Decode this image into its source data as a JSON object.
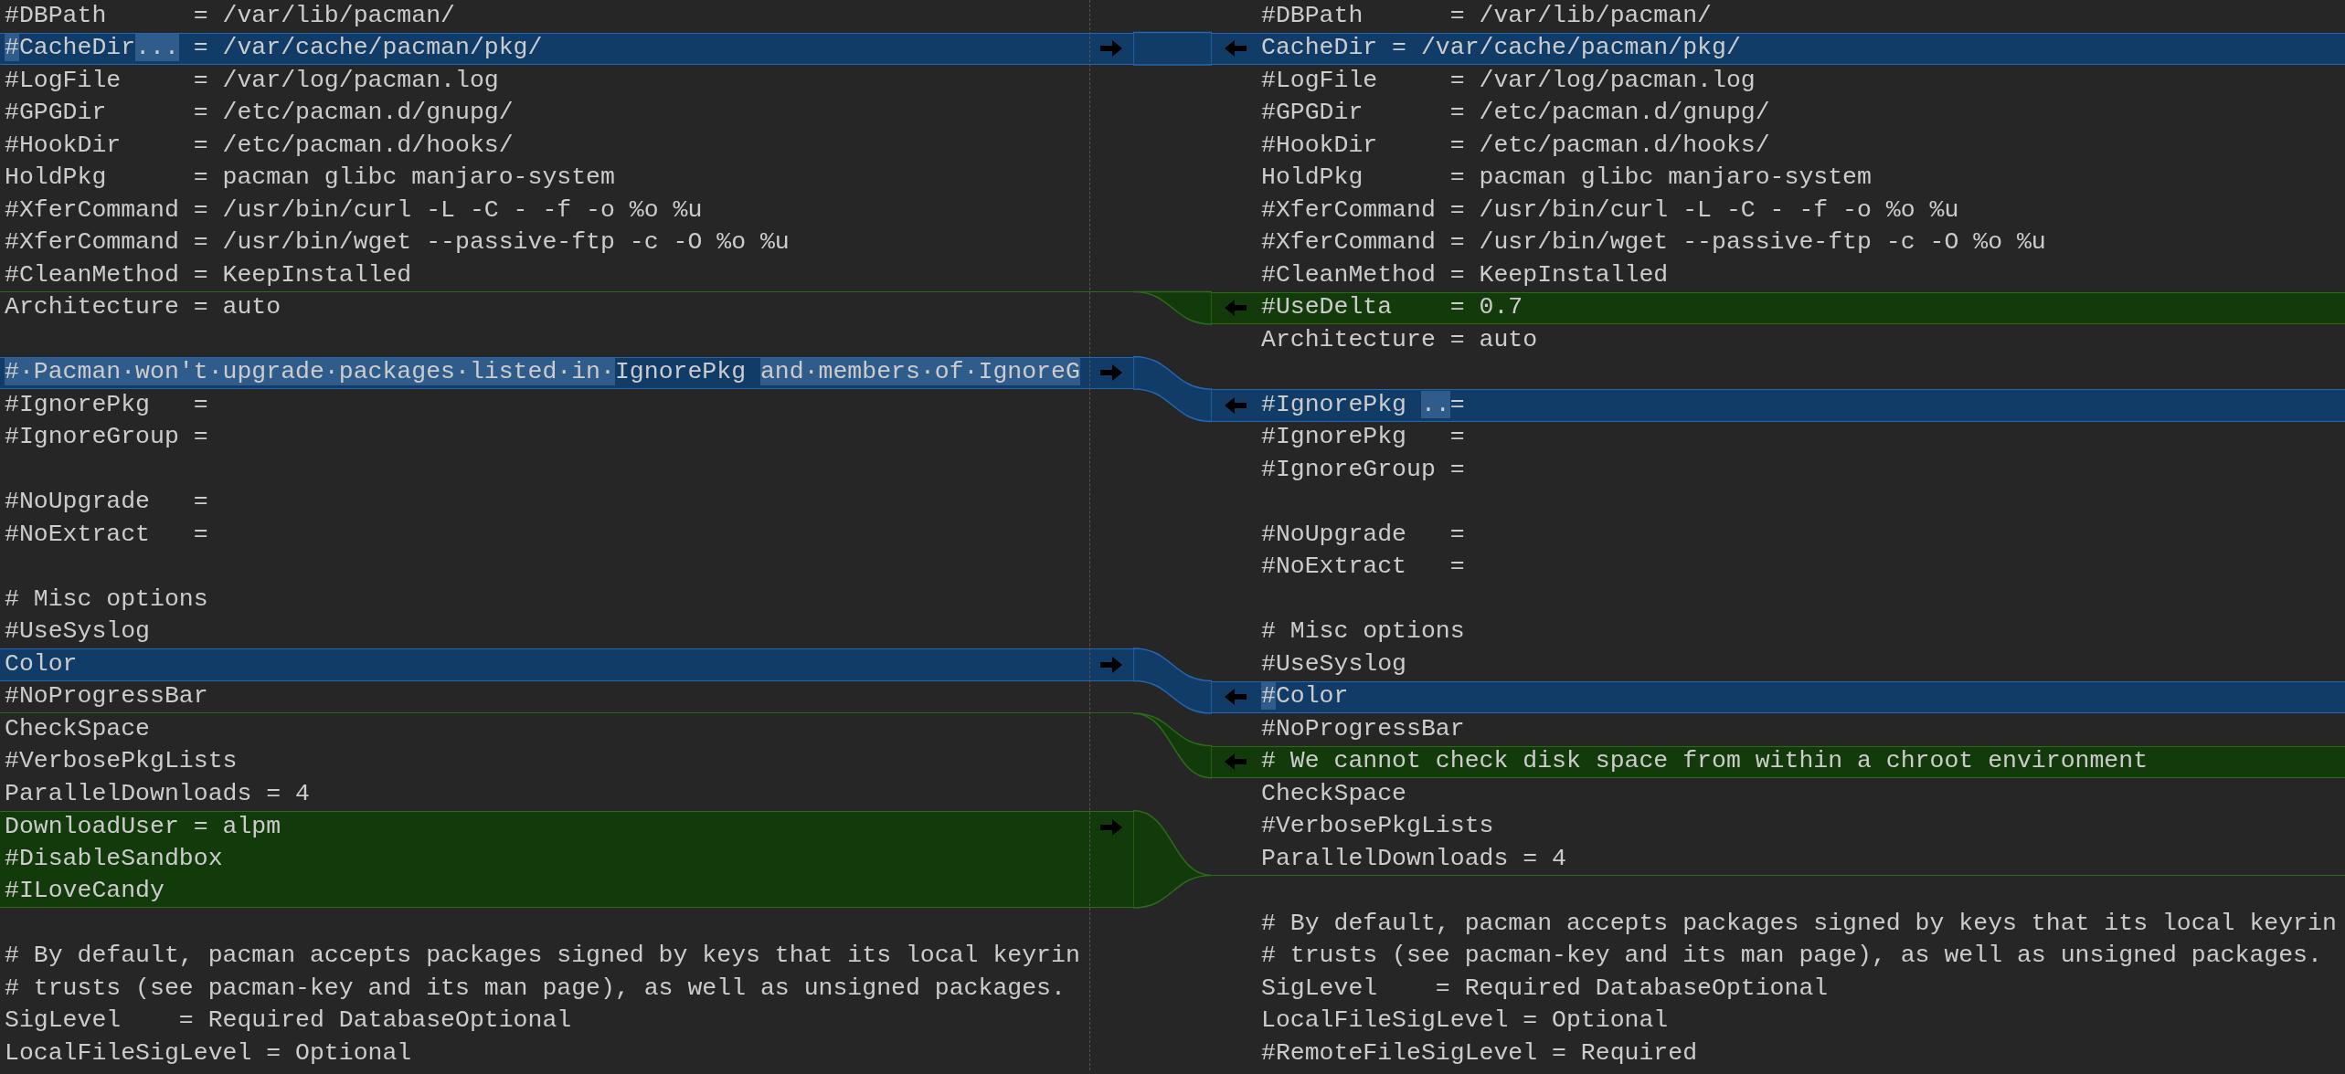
{
  "blocks": [
    {
      "kind": "equal",
      "left": [
        {
          "kind": "text",
          "text": "#DBPath      = /var/lib/pacman/"
        }
      ],
      "right": [
        {
          "kind": "text",
          "text": "#DBPath      = /var/lib/pacman/"
        }
      ]
    },
    {
      "kind": "changed",
      "left": [
        {
          "kind": "diff",
          "segments": [
            {
              "text": "#",
              "highlight": true
            },
            {
              "text": "CacheDir",
              "highlight": false
            },
            {
              "text": "...",
              "highlight": true
            },
            {
              "text": " = /var/cache/pacman/pkg/",
              "highlight": false
            }
          ]
        }
      ],
      "right": [
        {
          "kind": "diff",
          "segments": [
            {
              "text": "CacheDir = /var/cache/pacman/pkg/",
              "highlight": false
            }
          ]
        }
      ]
    },
    {
      "kind": "equal",
      "left": [
        {
          "kind": "text",
          "text": "#LogFile     = /var/log/pacman.log"
        },
        {
          "kind": "text",
          "text": "#GPGDir      = /etc/pacman.d/gnupg/"
        },
        {
          "kind": "text",
          "text": "#HookDir     = /etc/pacman.d/hooks/"
        },
        {
          "kind": "text",
          "text": "HoldPkg      = pacman glibc manjaro-system"
        },
        {
          "kind": "text",
          "text": "#XferCommand = /usr/bin/curl -L -C - -f -o %o %u"
        },
        {
          "kind": "text",
          "text": "#XferCommand = /usr/bin/wget --passive-ftp -c -O %o %u"
        },
        {
          "kind": "text",
          "text": "#CleanMethod = KeepInstalled"
        }
      ],
      "right": [
        {
          "kind": "text",
          "text": "#LogFile     = /var/log/pacman.log"
        },
        {
          "kind": "text",
          "text": "#GPGDir      = /etc/pacman.d/gnupg/"
        },
        {
          "kind": "text",
          "text": "#HookDir     = /etc/pacman.d/hooks/"
        },
        {
          "kind": "text",
          "text": "HoldPkg      = pacman glibc manjaro-system"
        },
        {
          "kind": "text",
          "text": "#XferCommand = /usr/bin/curl -L -C - -f -o %o %u"
        },
        {
          "kind": "text",
          "text": "#XferCommand = /usr/bin/wget --passive-ftp -c -O %o %u"
        },
        {
          "kind": "text",
          "text": "#CleanMethod = KeepInstalled"
        }
      ]
    },
    {
      "kind": "inserted",
      "right": [
        {
          "kind": "text",
          "text": "#UseDelta    = 0.7"
        }
      ]
    },
    {
      "kind": "equal",
      "left": [
        {
          "kind": "text",
          "text": "Architecture = auto"
        },
        {
          "kind": "blank"
        }
      ],
      "right": [
        {
          "kind": "text",
          "text": "Architecture = auto"
        },
        {
          "kind": "blank"
        }
      ]
    },
    {
      "kind": "changed",
      "left": [
        {
          "kind": "diff",
          "segments": [
            {
              "text": "#·Pacman·won't·upgrade·packages·listed·in·",
              "highlight": true
            },
            {
              "text": "IgnorePkg ",
              "highlight": false
            },
            {
              "text": "and·members·of·IgnoreG",
              "highlight": true
            }
          ]
        }
      ],
      "right": [
        {
          "kind": "diff",
          "segments": [
            {
              "text": "#IgnorePkg ",
              "highlight": false
            },
            {
              "text": "..",
              "highlight": true
            },
            {
              "text": "=",
              "highlight": false
            }
          ]
        }
      ]
    },
    {
      "kind": "equal",
      "left": [
        {
          "kind": "text",
          "text": "#IgnorePkg   ="
        },
        {
          "kind": "text",
          "text": "#IgnoreGroup ="
        },
        {
          "kind": "blank"
        },
        {
          "kind": "text",
          "text": "#NoUpgrade   ="
        },
        {
          "kind": "text",
          "text": "#NoExtract   ="
        },
        {
          "kind": "blank"
        },
        {
          "kind": "text",
          "text": "# Misc options"
        },
        {
          "kind": "text",
          "text": "#UseSyslog"
        }
      ],
      "right": [
        {
          "kind": "text",
          "text": "#IgnorePkg   ="
        },
        {
          "kind": "text",
          "text": "#IgnoreGroup ="
        },
        {
          "kind": "blank"
        },
        {
          "kind": "text",
          "text": "#NoUpgrade   ="
        },
        {
          "kind": "text",
          "text": "#NoExtract   ="
        },
        {
          "kind": "blank"
        },
        {
          "kind": "text",
          "text": "# Misc options"
        },
        {
          "kind": "text",
          "text": "#UseSyslog"
        }
      ]
    },
    {
      "kind": "changed",
      "left": [
        {
          "kind": "diff",
          "segments": [
            {
              "text": "Color",
              "highlight": false
            }
          ]
        }
      ],
      "right": [
        {
          "kind": "diff",
          "segments": [
            {
              "text": "#",
              "highlight": true
            },
            {
              "text": "Color",
              "highlight": false
            }
          ]
        }
      ]
    },
    {
      "kind": "equal",
      "left": [
        {
          "kind": "text",
          "text": "#NoProgressBar"
        }
      ],
      "right": [
        {
          "kind": "text",
          "text": "#NoProgressBar"
        }
      ]
    },
    {
      "kind": "inserted",
      "right": [
        {
          "kind": "text",
          "text": "# We cannot check disk space from within a chroot environment"
        }
      ]
    },
    {
      "kind": "equal",
      "left": [
        {
          "kind": "text",
          "text": "CheckSpace"
        },
        {
          "kind": "text",
          "text": "#VerbosePkgLists"
        },
        {
          "kind": "text",
          "text": "ParallelDownloads = 4"
        }
      ],
      "right": [
        {
          "kind": "text",
          "text": "CheckSpace"
        },
        {
          "kind": "text",
          "text": "#VerbosePkgLists"
        },
        {
          "kind": "text",
          "text": "ParallelDownloads = 4"
        }
      ]
    },
    {
      "kind": "inserted",
      "left": [
        {
          "kind": "text",
          "text": "DownloadUser = alpm"
        },
        {
          "kind": "text",
          "text": "#DisableSandbox"
        },
        {
          "kind": "text",
          "text": "#ILoveCandy"
        }
      ]
    },
    {
      "kind": "equal",
      "left": [
        {
          "kind": "blank"
        },
        {
          "kind": "text",
          "text": "# By default, pacman accepts packages signed by keys that its local keyrin"
        },
        {
          "kind": "text",
          "text": "# trusts (see pacman-key and its man page), as well as unsigned packages."
        },
        {
          "kind": "text",
          "text": "SigLevel    = Required DatabaseOptional"
        },
        {
          "kind": "text",
          "text": "LocalFileSigLevel = Optional"
        }
      ],
      "right": [
        {
          "kind": "blank"
        },
        {
          "kind": "text",
          "text": "# By default, pacman accepts packages signed by keys that its local keyrin"
        },
        {
          "kind": "text",
          "text": "# trusts (see pacman-key and its man page), as well as unsigned packages."
        },
        {
          "kind": "text",
          "text": "SigLevel    = Required DatabaseOptional"
        },
        {
          "kind": "text",
          "text": "LocalFileSigLevel = Optional"
        },
        {
          "kind": "text",
          "text": "#RemoteFileSigLevel = Required"
        }
      ]
    }
  ]
}
